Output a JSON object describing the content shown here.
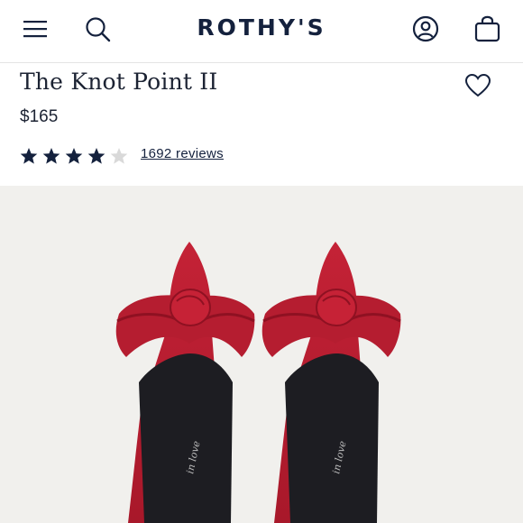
{
  "header": {
    "brand": "ROTHY'S",
    "menu_icon": "menu-icon",
    "search_icon": "search-icon",
    "account_icon": "account-icon",
    "bag_icon": "bag-icon"
  },
  "product": {
    "title": "The Knot Point II",
    "price": "$165",
    "rating": 4,
    "rating_max": 5,
    "reviews_label": "1692 reviews",
    "wishlist_icon": "heart-icon",
    "image_alt": "Red knit pointed flats with knot detail",
    "insole_text": "in love"
  },
  "colors": {
    "navy": "#14213d",
    "shoe_red": "#b0182b",
    "photo_bg": "#f1f0ed",
    "star_empty": "#d9d9d9"
  }
}
